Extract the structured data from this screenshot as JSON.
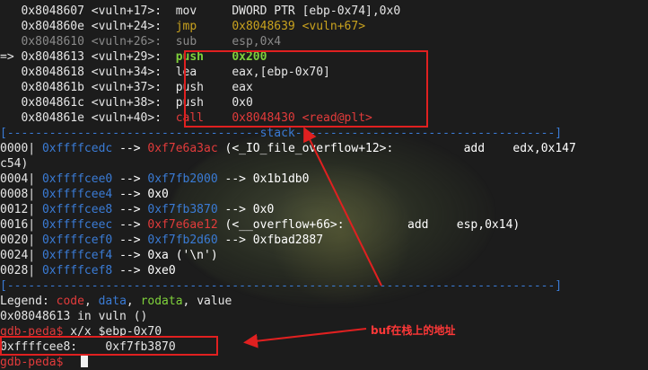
{
  "disasm": [
    {
      "marker": "",
      "addr": "0x8048607",
      "func": "<vuln+17>:",
      "mnemonic": "mov",
      "operands": "DWORD PTR [ebp-0x74],0x0",
      "style": "normal"
    },
    {
      "marker": "",
      "addr": "0x804860e",
      "func": "<vuln+24>:",
      "mnemonic": "jmp",
      "operands": "0x8048639 <vuln+67>",
      "style": "jmp"
    },
    {
      "marker": "",
      "addr": "0x8048610",
      "func": "<vuln+26>:",
      "mnemonic": "sub",
      "operands": "esp,0x4",
      "style": "dim"
    },
    {
      "marker": "=>",
      "addr": "0x8048613",
      "func": "<vuln+29>:",
      "mnemonic": "push",
      "operands": "0x200",
      "style": "current"
    },
    {
      "marker": "",
      "addr": "0x8048618",
      "func": "<vuln+34>:",
      "mnemonic": "lea",
      "operands": "eax,[ebp-0x70]",
      "style": "normal"
    },
    {
      "marker": "",
      "addr": "0x804861b",
      "func": "<vuln+37>:",
      "mnemonic": "push",
      "operands": "eax",
      "style": "normal"
    },
    {
      "marker": "",
      "addr": "0x804861c",
      "func": "<vuln+38>:",
      "mnemonic": "push",
      "operands": "0x0",
      "style": "normal"
    },
    {
      "marker": "",
      "addr": "0x804861e",
      "func": "<vuln+40>:",
      "mnemonic": "call",
      "operands": "0x8048430 <read@plt>",
      "style": "call"
    }
  ],
  "stack_separator": "[------------------------------------stack-------------------------------------]",
  "stack": [
    {
      "off": "0000|",
      "addr": "0xffffcedc",
      "chain": [
        {
          "t": " --> ",
          "c": "white"
        },
        {
          "t": "0xf7e6a3ac",
          "c": "red"
        },
        {
          "t": " (<_IO_file_overflow+12>:          add    edx,0x147",
          "c": "white"
        }
      ]
    },
    {
      "off": "c54)",
      "addr": "",
      "chain": []
    },
    {
      "off": "0004|",
      "addr": "0xffffcee0",
      "chain": [
        {
          "t": " --> ",
          "c": "white"
        },
        {
          "t": "0xf7fb2000",
          "c": "blue"
        },
        {
          "t": " --> 0x1b1db0",
          "c": "white"
        }
      ]
    },
    {
      "off": "0008|",
      "addr": "0xffffcee4",
      "chain": [
        {
          "t": " --> 0x0",
          "c": "white"
        }
      ]
    },
    {
      "off": "0012|",
      "addr": "0xffffcee8",
      "chain": [
        {
          "t": " --> ",
          "c": "white"
        },
        {
          "t": "0xf7fb3870",
          "c": "blue"
        },
        {
          "t": " --> 0x0",
          "c": "white"
        }
      ]
    },
    {
      "off": "0016|",
      "addr": "0xffffceec",
      "chain": [
        {
          "t": " --> ",
          "c": "white"
        },
        {
          "t": "0xf7e6ae12",
          "c": "red"
        },
        {
          "t": " (<__overflow+66>:         add    esp,0x14)",
          "c": "white"
        }
      ]
    },
    {
      "off": "0020|",
      "addr": "0xffffcef0",
      "chain": [
        {
          "t": " --> ",
          "c": "white"
        },
        {
          "t": "0xf7fb2d60",
          "c": "blue"
        },
        {
          "t": " --> 0xfbad2887",
          "c": "white"
        }
      ]
    },
    {
      "off": "0024|",
      "addr": "0xffffcef4",
      "chain": [
        {
          "t": " --> 0xa ('\\n')",
          "c": "white"
        }
      ]
    },
    {
      "off": "0028|",
      "addr": "0xffffcef8",
      "chain": [
        {
          "t": " --> 0xe0",
          "c": "white"
        }
      ]
    }
  ],
  "bottom_separator": "[------------------------------------------------------------------------------]",
  "legend": {
    "prefix": "Legend: ",
    "code": "code",
    "data": "data",
    "rodata": "rodata",
    "value": "value",
    "sep": ", "
  },
  "location_line": "0x08048613 in vuln ()",
  "prompt": "gdb-peda$",
  "command": " x/x $ebp-0x70",
  "result_addr": "0xffffcee8:",
  "result_value": "0xf7fb3870",
  "annotation": "buf在栈上的地址",
  "colors": {
    "accent_red": "#e02020",
    "code": "#e23b3b",
    "data": "#3a7bd5",
    "rodata": "#7fd13b",
    "jmp": "#c9a21e"
  }
}
